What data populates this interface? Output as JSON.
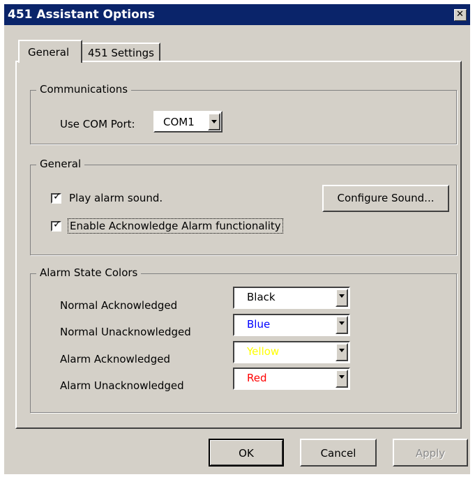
{
  "window": {
    "title": "451 Assistant Options",
    "close_glyph": "✕"
  },
  "tabs": [
    {
      "label": "General",
      "selected": true
    },
    {
      "label": "451 Settings",
      "selected": false
    }
  ],
  "communications": {
    "group_label": "Communications",
    "com_port_label": "Use COM Port:",
    "com_port_value": "COM1"
  },
  "general": {
    "group_label": "General",
    "play_alarm_label": "Play alarm sound.",
    "play_alarm_checked": true,
    "enable_ack_label": "Enable Acknowledge Alarm functionality",
    "enable_ack_checked": true,
    "configure_sound_label": "Configure Sound..."
  },
  "alarm_colors": {
    "group_label": "Alarm State Colors",
    "rows": [
      {
        "label": "Normal Acknowledged",
        "value": "Black",
        "color": "#000000"
      },
      {
        "label": "Normal Unacknowledged",
        "value": "Blue",
        "color": "#0000ff"
      },
      {
        "label": "Alarm Acknowledged",
        "value": "Yellow",
        "color": "#ffff00"
      },
      {
        "label": "Alarm Unacknowledged",
        "value": "Red",
        "color": "#ff0000"
      }
    ]
  },
  "buttons": {
    "ok": "OK",
    "cancel": "Cancel",
    "apply": "Apply",
    "apply_enabled": false
  },
  "icons": {
    "check": "✓",
    "close": "close-icon",
    "dropdown": "chevron-down-icon"
  }
}
